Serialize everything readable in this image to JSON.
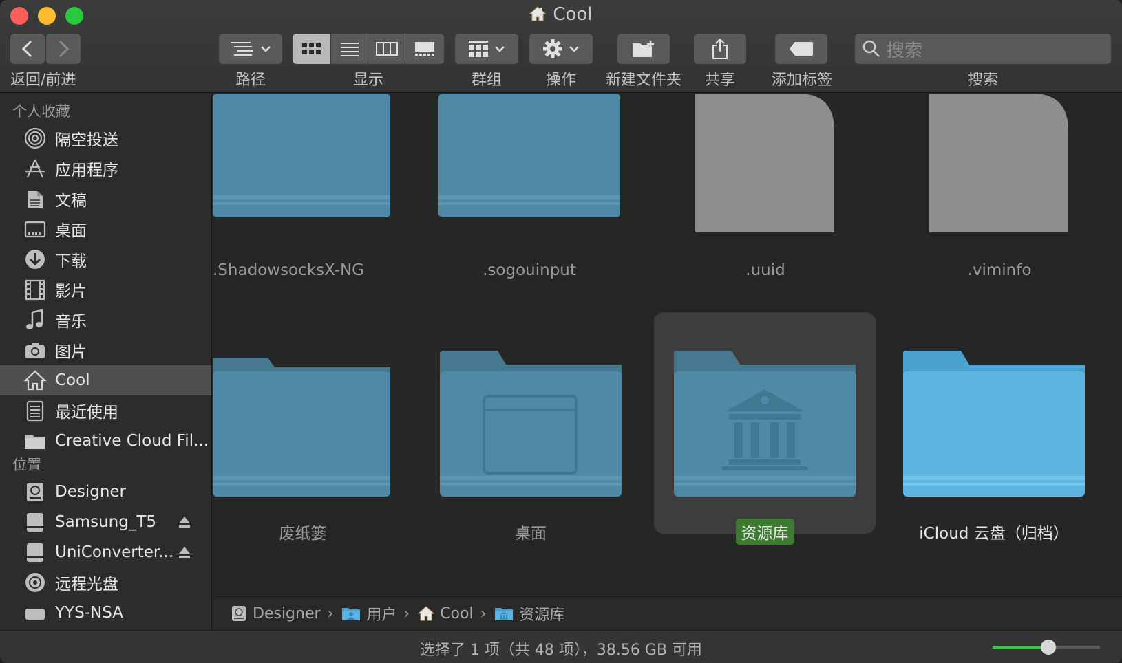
{
  "window": {
    "title": "Cool"
  },
  "toolbar": {
    "nav_label": "返回/前进",
    "path_label": "路径",
    "view_label": "显示",
    "group_label": "群组",
    "action_label": "操作",
    "new_folder_label": "新建文件夹",
    "share_label": "共享",
    "tag_label": "添加标签",
    "search_label": "搜索",
    "search_placeholder": "搜索"
  },
  "sidebar": {
    "favorites_header": "个人收藏",
    "favorites": [
      {
        "label": "隔空投送",
        "icon": "airdrop-icon"
      },
      {
        "label": "应用程序",
        "icon": "applications-icon"
      },
      {
        "label": "文稿",
        "icon": "documents-icon"
      },
      {
        "label": "桌面",
        "icon": "desktop-icon"
      },
      {
        "label": "下载",
        "icon": "downloads-icon"
      },
      {
        "label": "影片",
        "icon": "movies-icon"
      },
      {
        "label": "音乐",
        "icon": "music-icon"
      },
      {
        "label": "图片",
        "icon": "pictures-icon"
      },
      {
        "label": "Cool",
        "icon": "home-icon",
        "selected": true
      },
      {
        "label": "最近使用",
        "icon": "recents-icon"
      },
      {
        "label": "Creative Cloud Fil...",
        "icon": "folder-icon"
      }
    ],
    "locations_header": "位置",
    "locations": [
      {
        "label": "Designer",
        "icon": "hard-drive-icon"
      },
      {
        "label": "Samsung_T5",
        "icon": "external-drive-icon",
        "eject": true
      },
      {
        "label": "UniConverter...",
        "icon": "external-drive-icon",
        "eject": true
      },
      {
        "label": "远程光盘",
        "icon": "remote-disc-icon"
      },
      {
        "label": "YYS-NSA",
        "icon": "network-drive-icon"
      }
    ]
  },
  "files": [
    {
      "name": ".ShadowsocksX-NG",
      "kind": "folder"
    },
    {
      "name": ".sogouinput",
      "kind": "folder"
    },
    {
      "name": ".uuid",
      "kind": "document"
    },
    {
      "name": ".viminfo",
      "kind": "document"
    },
    {
      "name": "废纸篓",
      "kind": "folder"
    },
    {
      "name": "桌面",
      "kind": "desktop-folder"
    },
    {
      "name": "资源库",
      "kind": "library-folder",
      "selected": true
    },
    {
      "name": "iCloud 云盘（归档）",
      "kind": "icloud-folder"
    }
  ],
  "pathbar": {
    "crumbs": [
      "Designer",
      "用户",
      "Cool",
      "资源库"
    ]
  },
  "status": {
    "text": "选择了 1 项（共 48 项），38.56 GB 可用",
    "zoom_fraction": 0.52
  },
  "colors": {
    "folder": "#4e8aa6",
    "folder_back": "#46788f",
    "icloud_folder": "#5cb4e0",
    "selection_label": "#3c7a30",
    "slider": "#33c748"
  }
}
